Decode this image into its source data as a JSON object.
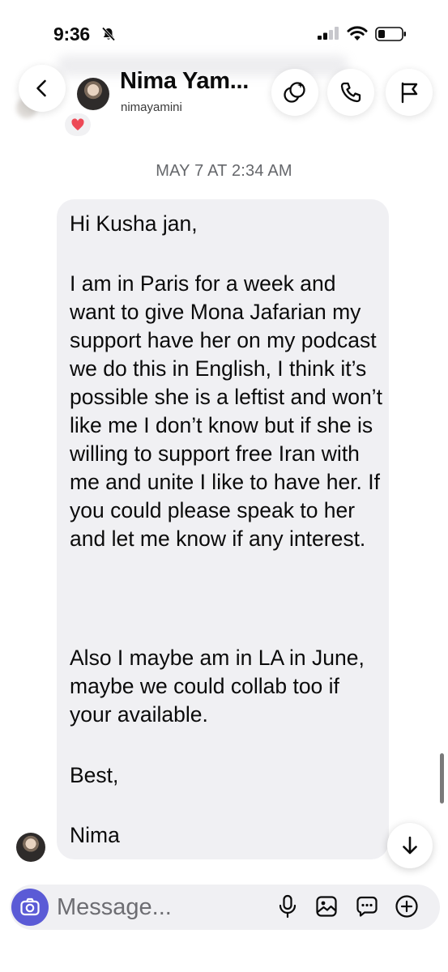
{
  "status": {
    "time": "9:36"
  },
  "header": {
    "name": "Nima Yam...",
    "handle": "nimayamini"
  },
  "thread": {
    "date_separator": "MAY 7 AT 2:34 AM",
    "message_paragraphs": [
      "Hi Kusha jan,",
      "I am in Paris for a week and want to give Mona Jafarian my support have her on my podcast we do this in English, I think it’s possible she is a leftist and won’t like me I don’t know but if she is willing to support free Iran with me and unite I like to have her. If you could please speak to her and let me know if any interest.",
      "Also I maybe am in LA in June, maybe we could collab too if your available.",
      "Best,",
      "Nima"
    ]
  },
  "composer": {
    "placeholder": "Message..."
  },
  "icons": {
    "back": "chevron-left-icon",
    "effects": "sparkle-effects-icon",
    "call": "phone-icon",
    "report": "flag-icon",
    "camera": "camera-icon",
    "mic": "microphone-icon",
    "gallery": "image-icon",
    "sticker": "chat-bubble-icon",
    "more": "plus-circle-icon",
    "scroll": "arrow-down-icon"
  },
  "colors": {
    "bubble": "#f0f0f3",
    "camera_button": "#5b5bd6",
    "secondary_text": "#65676b"
  }
}
